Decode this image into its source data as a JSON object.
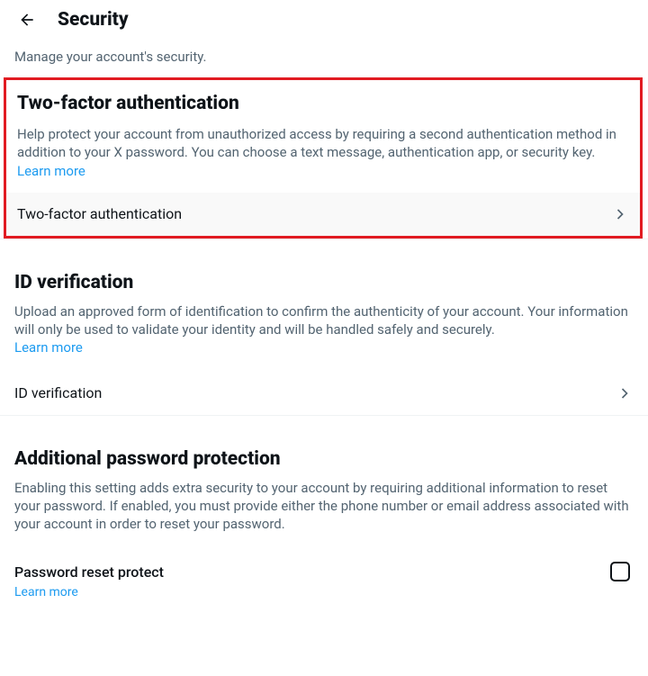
{
  "header": {
    "title": "Security"
  },
  "subtitle": "Manage your account's security.",
  "sections": {
    "twofa": {
      "title": "Two-factor authentication",
      "desc": "Help protect your account from unauthorized access by requiring a second authentication method in addition to your X password. You can choose a text message, authentication app, or security key. ",
      "learn": "Learn more",
      "navLabel": "Two-factor authentication"
    },
    "idv": {
      "title": "ID verification",
      "desc": "Upload an approved form of identification to confirm the authenticity of your account. Your information will only be used to validate your identity and will be handled safely and securely. ",
      "learn": "Learn more",
      "navLabel": "ID verification"
    },
    "app": {
      "title": "Additional password protection",
      "desc": "Enabling this setting adds extra security to your account by requiring additional information to reset your password. If enabled, you must provide either the phone number or email address associated with your account in order to reset your password.",
      "checkboxLabel": "Password reset protect",
      "learn": "Learn more"
    }
  }
}
